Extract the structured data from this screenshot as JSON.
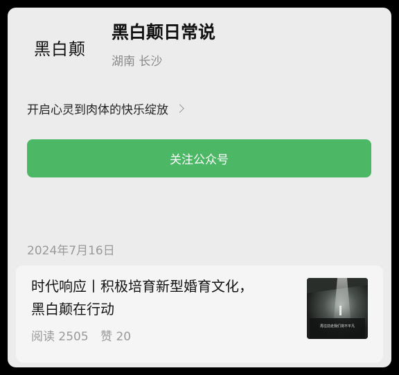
{
  "account": {
    "logo_text": "黑白颠",
    "name": "黑白颠日常说",
    "location": "湖南 长沙",
    "intro": "开启心灵到肉体的快乐绽放",
    "follow_label": "关注公众号"
  },
  "article": {
    "date": "2024年7月16日",
    "title_line1": "时代响应丨积极培育新型婚育文化，",
    "title_line2": "黑白颠在行动",
    "reads_label": "阅读 2505",
    "likes_label": "赞 20"
  },
  "thumbnail": {
    "caption": "再往前走我们将不平凡"
  }
}
